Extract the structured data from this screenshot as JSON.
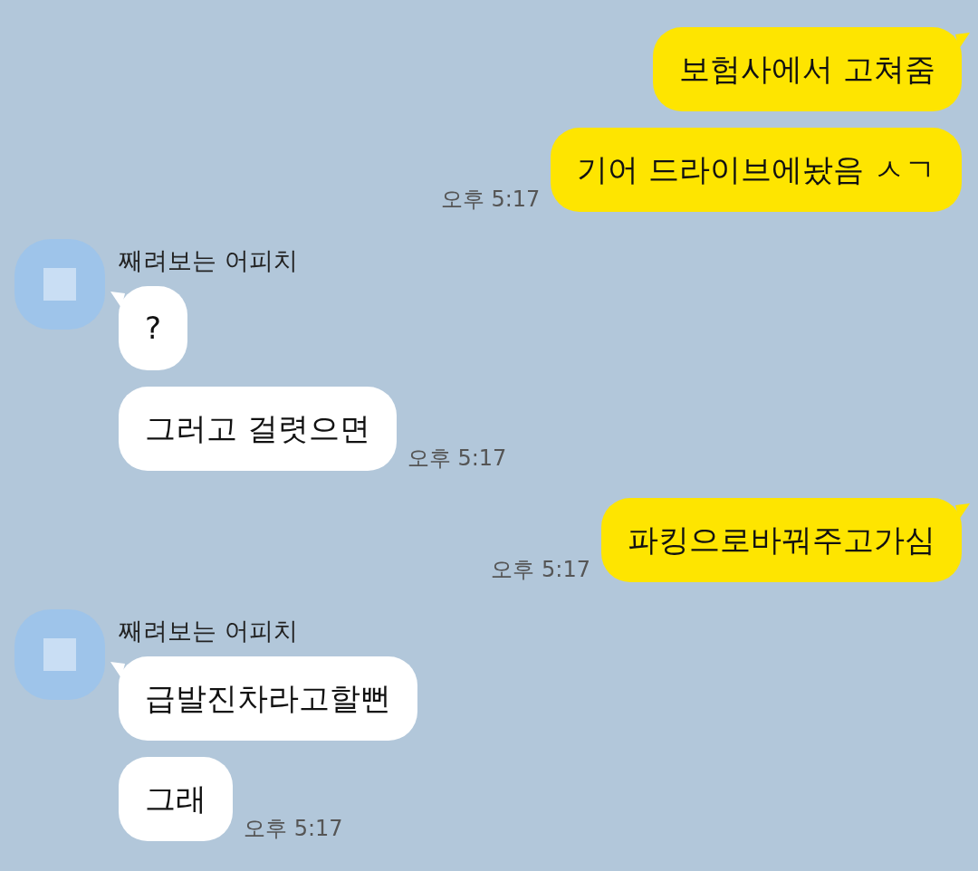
{
  "messages": [
    {
      "kind": "sent",
      "bubbles": [
        {
          "text": "보험사에서 고쳐줌",
          "tail": true
        },
        {
          "text": "기어 드라이브에놨음 ㅅㄱ",
          "tail": false
        }
      ],
      "time": "오후 5:17"
    },
    {
      "kind": "received",
      "sender": "째려보는 어피치",
      "bubbles": [
        {
          "text": "?",
          "tail": true
        },
        {
          "text": "그러고 걸렷으면",
          "tail": false
        }
      ],
      "time": "오후 5:17"
    },
    {
      "kind": "sent",
      "bubbles": [
        {
          "text": "파킹으로바꿔주고가심",
          "tail": true
        }
      ],
      "time": "오후 5:17"
    },
    {
      "kind": "received",
      "sender": "째려보는 어피치",
      "bubbles": [
        {
          "text": "급발진차라고할뻔",
          "tail": true
        },
        {
          "text": "그래",
          "tail": false
        }
      ],
      "time": "오후 5:17"
    }
  ]
}
